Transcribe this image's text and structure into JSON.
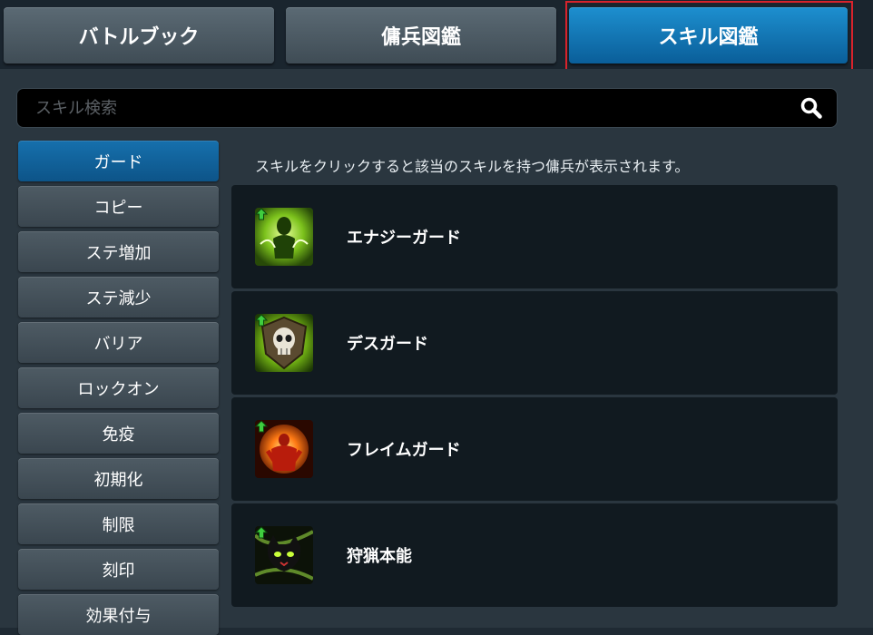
{
  "tabs": [
    {
      "label": "バトルブック",
      "active": false
    },
    {
      "label": "傭兵図鑑",
      "active": false
    },
    {
      "label": "スキル図鑑",
      "active": true
    }
  ],
  "search": {
    "placeholder": "スキル検索",
    "value": "",
    "icon": "search-icon"
  },
  "categories": [
    {
      "label": "ガード",
      "active": true
    },
    {
      "label": "コピー"
    },
    {
      "label": "ステ増加"
    },
    {
      "label": "ステ減少"
    },
    {
      "label": "バリア"
    },
    {
      "label": "ロックオン"
    },
    {
      "label": "免疫"
    },
    {
      "label": "初期化"
    },
    {
      "label": "制限"
    },
    {
      "label": "刻印"
    },
    {
      "label": "効果付与"
    }
  ],
  "hint": "スキルをクリックすると該当のスキルを持つ傭兵が表示されます。",
  "skills": [
    {
      "name": "エナジーガード",
      "icon": "energy-guard-icon"
    },
    {
      "name": "デスガード",
      "icon": "death-guard-icon"
    },
    {
      "name": "フレイムガード",
      "icon": "flame-guard-icon"
    },
    {
      "name": "狩猟本能",
      "icon": "hunting-instinct-icon"
    }
  ],
  "colors": {
    "accent": "#0d5f9c",
    "highlight_border": "#d8232c",
    "background": "#2a363f"
  }
}
